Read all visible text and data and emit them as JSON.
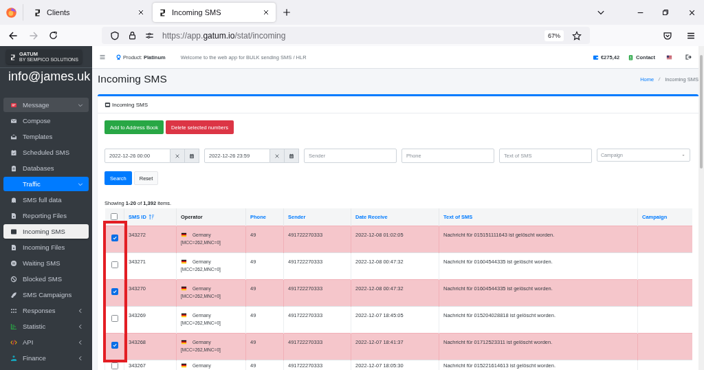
{
  "browser": {
    "tabs": [
      {
        "title": "Clients",
        "selected": false
      },
      {
        "title": "Incoming SMS",
        "selected": true
      }
    ],
    "url": {
      "prefix": "https://app.",
      "domain": "gatum.io",
      "path": "/stat/incoming"
    },
    "zoom": "67%"
  },
  "sidebar": {
    "logo": {
      "name": "GATUM",
      "tagline": "BY SEMPICO SOLUTIONS"
    },
    "user": "info@james.uk",
    "items": [
      {
        "label": "Message",
        "selected": false,
        "expanded": true,
        "children": [
          {
            "label": "Compose",
            "selected": false
          },
          {
            "label": "Templates",
            "selected": false
          },
          {
            "label": "Scheduled SMS",
            "selected": false
          },
          {
            "label": "Databases",
            "selected": false
          },
          {
            "label": "Traffic",
            "selected": true,
            "expanded": true,
            "children": [
              {
                "label": "SMS full data",
                "selected": false
              },
              {
                "label": "Reporting Files",
                "selected": false
              },
              {
                "label": "Incoming SMS",
                "selected": true
              },
              {
                "label": "Incoming Files",
                "selected": false
              },
              {
                "label": "Waiting SMS",
                "selected": false
              },
              {
                "label": "Blocked SMS",
                "selected": false
              },
              {
                "label": "SMS Campaigns",
                "selected": false
              }
            ]
          }
        ]
      },
      {
        "label": "Responses",
        "selected": false,
        "expanded": false
      },
      {
        "label": "Statistic",
        "selected": false,
        "expanded": false
      },
      {
        "label": "API",
        "selected": false,
        "expanded": false
      },
      {
        "label": "Finance",
        "selected": false,
        "expanded": false
      }
    ]
  },
  "topbar": {
    "product": "Product: **Platinum**",
    "welcome": "Welcome to the web app for BULK sending SMS / HLR",
    "balance": "€275,42",
    "contact": "Contact"
  },
  "page": {
    "title": "Incoming SMS",
    "breadcrumb": [
      "Home",
      "Incoming SMS"
    ]
  },
  "card": {
    "title": "Incoming SMS",
    "buttons": [
      {
        "label": "Add to Address Book",
        "kind": "success"
      },
      {
        "label": "Delete selected numbers",
        "kind": "danger"
      }
    ],
    "filters": {
      "date_from": "2022-12-26 00:00",
      "date_to": "2022-12-26 23:59",
      "fields": [
        {
          "placeholder": "Sender"
        },
        {
          "placeholder": "Phone"
        },
        {
          "placeholder": "Text of SMS"
        }
      ],
      "campaign": {
        "placeholder": "Campaign"
      }
    },
    "actions": [
      {
        "label": "Search",
        "kind": "primary"
      },
      {
        "label": "Reset",
        "kind": "light"
      }
    ],
    "summary": "Showing **1-20** of **1,392** items."
  },
  "table": {
    "select_all": {
      "checked": false
    },
    "columns": [
      {
        "label": "SMS ID",
        "link": true,
        "sorted": true
      },
      {
        "label": "Operator",
        "link": false,
        "sorted": false
      },
      {
        "label": "Phone",
        "link": true,
        "sorted": false
      },
      {
        "label": "Sender",
        "link": true,
        "sorted": false
      },
      {
        "label": "Date Receive",
        "link": true,
        "sorted": false
      },
      {
        "label": "Text of SMS",
        "link": true,
        "sorted": false
      },
      {
        "label": "Campaign",
        "link": true,
        "sorted": false
      }
    ],
    "rows": [
      {
        "selected": true,
        "id": "343272",
        "country": "Germany",
        "codes": "[MCC=262,MNC=0]",
        "phone": "49",
        "sender": "491722270333",
        "date": "2022-12-08 01:02:05",
        "text": "Nachricht für 015151111643 ist gelöscht worden."
      },
      {
        "selected": false,
        "id": "343271",
        "country": "Germany",
        "codes": "[MCC=262,MNC=0]",
        "phone": "49",
        "sender": "491722270333",
        "date": "2022-12-08 00:47:32",
        "text": "Nachricht für 01604544335 ist gelöscht worden."
      },
      {
        "selected": true,
        "id": "343270",
        "country": "Germany",
        "codes": "[MCC=262,MNC=0]",
        "phone": "49",
        "sender": "491722270333",
        "date": "2022-12-08 00:47:32",
        "text": "Nachricht für 01604544335 ist gelöscht worden."
      },
      {
        "selected": false,
        "id": "343269",
        "country": "Germany",
        "codes": "[MCC=262,MNC=0]",
        "phone": "49",
        "sender": "491722270333",
        "date": "2022-12-07 18:45:05",
        "text": "Nachricht für 015204028818 ist gelöscht worden."
      },
      {
        "selected": true,
        "id": "343268",
        "country": "Germany",
        "codes": "[MCC=262,MNC=0]",
        "phone": "49",
        "sender": "491722270333",
        "date": "2022-12-07 18:41:37",
        "text": "Nachricht für 01712523311 ist gelöscht worden."
      },
      {
        "selected": false,
        "id": "343267",
        "country": "Germany",
        "phone": "49",
        "sender": "491722270333",
        "date": "2022-12-07 18:05:30",
        "text": "Nachricht für 015221614613 ist gelöscht worden."
      }
    ]
  }
}
